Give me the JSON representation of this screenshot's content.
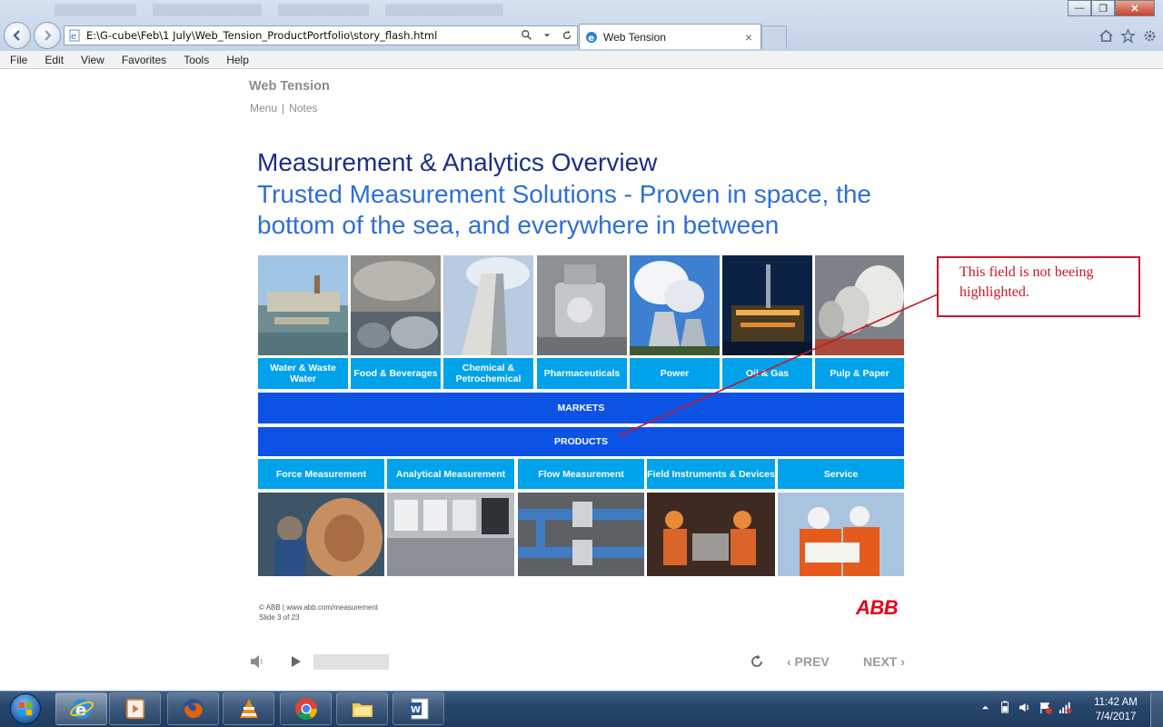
{
  "browser": {
    "address": "E:\\G-cube\\Feb\\1 July\\Web_Tension_ProductPortfolio\\story_flash.html",
    "tab_title": "Web Tension",
    "tab_close": "×",
    "menu": [
      "File",
      "Edit",
      "View",
      "Favorites",
      "Tools",
      "Help"
    ],
    "window_controls": {
      "minimize": "—",
      "maximize": "❐",
      "close": "✕"
    }
  },
  "story": {
    "title": "Web Tension",
    "links": {
      "menu": "Menu",
      "separator": "|",
      "notes": "Notes"
    }
  },
  "slide": {
    "heading": "Measurement & Analytics Overview",
    "subheading": "Trusted Measurement Solutions - Proven in space, the bottom of the sea, and everywhere in between",
    "markets": [
      {
        "label": "Water & Waste Water",
        "photo": "water-treatment-photo"
      },
      {
        "label": "Food & Beverages",
        "photo": "brewery-tanks-photo"
      },
      {
        "label": "Chemical & Petrochemical",
        "photo": "chimney-photo"
      },
      {
        "label": "Pharmaceuticals",
        "photo": "pharma-equipment-photo"
      },
      {
        "label": "Power",
        "photo": "cooling-towers-photo"
      },
      {
        "label": "Oil & Gas",
        "photo": "offshore-platform-photo"
      },
      {
        "label": "Pulp & Paper",
        "photo": "paper-rolls-photo"
      }
    ],
    "markets_bar": "MARKETS",
    "products_bar": "PRODUCTS",
    "products": [
      {
        "label": "Force Measurement",
        "photo": "copper-roll-photo"
      },
      {
        "label": "Analytical Measurement",
        "photo": "analyzer-panels-photo"
      },
      {
        "label": "Flow Measurement",
        "photo": "flow-pipes-photo"
      },
      {
        "label": "Field Instruments & Devices",
        "photo": "field-workers-photo"
      },
      {
        "label": "Service",
        "photo": "service-engineers-photo"
      }
    ],
    "footer_line1": "© ABB | www.abb.com/measurement",
    "footer_line2": "Slide 3 of 23",
    "logo": "ABB"
  },
  "annotation": {
    "text": "This field is not beeing highlighted.",
    "color": "#c6172b"
  },
  "player": {
    "prev": "‹ PREV",
    "next": "NEXT ›"
  },
  "taskbar": {
    "time": "11:42 AM",
    "date": "7/4/2017",
    "pinned": [
      "internet-explorer",
      "media-player",
      "firefox",
      "vlc",
      "chrome",
      "file-explorer",
      "word"
    ]
  },
  "colors": {
    "tile": "#00a2ea",
    "bar": "#0c52e4",
    "heading": "#1b2f86",
    "subheading": "#2e6fd6"
  }
}
